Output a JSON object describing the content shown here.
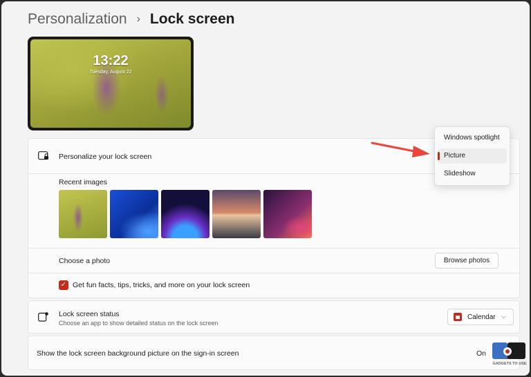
{
  "breadcrumb": {
    "parent": "Personalization",
    "separator": "›",
    "current": "Lock screen"
  },
  "preview": {
    "time": "13:22",
    "date": "Tuesday, August 22"
  },
  "personalize": {
    "icon": "lock-screen-icon",
    "title": "Personalize your lock screen",
    "recent_label": "Recent images",
    "recent_images": [
      "flowers-butterflies",
      "blue-bloom",
      "glow-curve",
      "sunset-lake",
      "purple-ribbon"
    ],
    "choose_photo_label": "Choose a photo",
    "browse_button": "Browse photos",
    "fun_facts_label": "Get fun facts, tips, tricks, and more on your lock screen",
    "fun_facts_checked": true
  },
  "dropdown": {
    "options": [
      "Windows spotlight",
      "Picture",
      "Slideshow"
    ],
    "selected": "Picture"
  },
  "status": {
    "icon": "lock-screen-status-icon",
    "title": "Lock screen status",
    "subtitle": "Choose an app to show detailed status on the lock screen",
    "app_icon": "calendar-icon",
    "app_value": "Calendar"
  },
  "signin": {
    "label": "Show the lock screen background picture on the sign-in screen",
    "value": "On"
  },
  "watermark": {
    "text": "GADGETS TO USE"
  },
  "colors": {
    "accent": "#c42b1c",
    "arrow": "#e8473a",
    "background": "#f3f3f3",
    "card": "#fbfbfb"
  }
}
